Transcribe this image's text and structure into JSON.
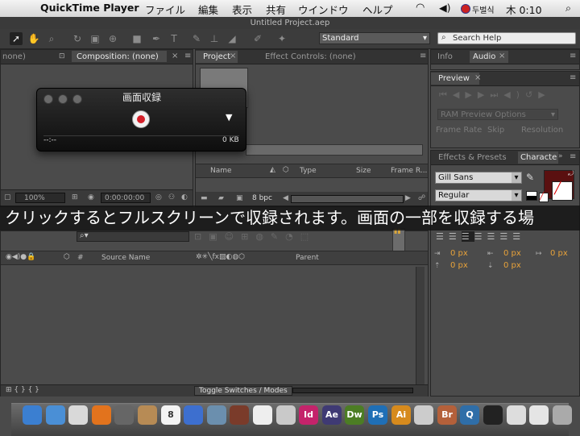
{
  "menubar": {
    "app_name": "QuickTime Player",
    "items": [
      "ファイル",
      "編集",
      "表示",
      "共有",
      "ウインドウ",
      "ヘルプ"
    ],
    "input_method": "두벌식",
    "clock": "木 0:10"
  },
  "window": {
    "title": "Untitled Project.aep"
  },
  "toolbar": {
    "workspace": "Standard",
    "search_placeholder": "Search Help"
  },
  "composition_panel": {
    "tab_left": "none)",
    "tab_label": "Composition: (none)",
    "zoom": "100%",
    "timecode": "0:00:00:00"
  },
  "project_panel": {
    "tab_project": "Project",
    "tab_effect_controls": "Effect Controls: (none)",
    "columns": [
      "Name",
      "Type",
      "Size",
      "Frame R..."
    ],
    "bpc": "8 bpc"
  },
  "info_panel": {
    "tab_info": "Info",
    "tab_audio": "Audio"
  },
  "preview_panel": {
    "title": "Preview",
    "ram_preview": "RAM Preview Options",
    "frame_rate": "Frame Rate",
    "skip": "Skip",
    "resolution": "Resolution"
  },
  "effects_panel": {
    "tab_effects": "Effects & Presets",
    "tab_character": "Characte"
  },
  "character_panel": {
    "font": "Gill Sans",
    "style": "Regular",
    "color": "#5a1010",
    "px_values": [
      "0 px",
      "0 px",
      "0 px",
      "0 px",
      "0 px"
    ]
  },
  "qt_recorder": {
    "title": "画面収録",
    "time": "--:--",
    "size": "0 KB"
  },
  "caption": {
    "text": "クリックするとフルスクリーンで収録されます。画面の一部を収録する場"
  },
  "timeline": {
    "columns": [
      "#",
      "Source Name",
      "Parent"
    ],
    "toggle_label": "Toggle Switches / Modes"
  },
  "dock": {
    "apps": [
      {
        "name": "finder",
        "label": "",
        "color": "#3b7fd1"
      },
      {
        "name": "safari",
        "label": "",
        "color": "#4a8fd6"
      },
      {
        "name": "chrome",
        "label": "",
        "color": "#d9d9d9"
      },
      {
        "name": "firefox",
        "label": "",
        "color": "#e2731d"
      },
      {
        "name": "rocket",
        "label": "",
        "color": "#666666"
      },
      {
        "name": "contacts",
        "label": "",
        "color": "#b78b55"
      },
      {
        "name": "calendar",
        "label": "8",
        "color": "#f3f3f3"
      },
      {
        "name": "itunes",
        "label": "",
        "color": "#3d6fcf"
      },
      {
        "name": "iphoto",
        "label": "",
        "color": "#6b8fae"
      },
      {
        "name": "photo-booth",
        "label": "",
        "color": "#7a3b2a"
      },
      {
        "name": "textedit",
        "label": "",
        "color": "#eeeeee"
      },
      {
        "name": "preview",
        "label": "",
        "color": "#c9c9c9"
      },
      {
        "name": "indesign",
        "label": "Id",
        "color": "#c4236b"
      },
      {
        "name": "after-effects",
        "label": "Ae",
        "color": "#3f3a74"
      },
      {
        "name": "dreamweaver",
        "label": "Dw",
        "color": "#4c7d24"
      },
      {
        "name": "photoshop",
        "label": "Ps",
        "color": "#1f6fb6"
      },
      {
        "name": "illustrator",
        "label": "Ai",
        "color": "#d68a1d"
      },
      {
        "name": "dvd",
        "label": "",
        "color": "#cccccc"
      },
      {
        "name": "bridge",
        "label": "Br",
        "color": "#b4603a"
      },
      {
        "name": "quicktime",
        "label": "Q",
        "color": "#2f6ea8"
      },
      {
        "name": "logic",
        "label": "",
        "color": "#222222"
      },
      {
        "name": "downloads",
        "label": "",
        "color": "#dddddd"
      },
      {
        "name": "documents",
        "label": "",
        "color": "#e5e5e5"
      },
      {
        "name": "trash",
        "label": "",
        "color": "#aaaaaa"
      }
    ]
  }
}
